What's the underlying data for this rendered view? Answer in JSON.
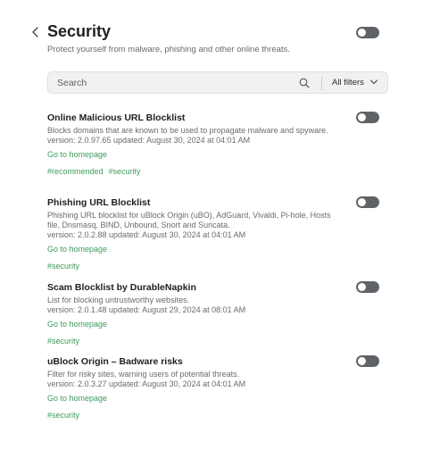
{
  "header": {
    "title": "Security",
    "subtitle": "Protect yourself from malware, phishing and other online threats."
  },
  "search": {
    "placeholder": "Search",
    "filters_label": "All filters"
  },
  "filters": [
    {
      "title": "Online Malicious URL Blocklist",
      "description": "Blocks domains that are known to be used to propagate malware and spyware.",
      "version": "version: 2.0.97.65 updated: August 30, 2024 at 04:01 AM",
      "homepage": "Go to homepage",
      "tags": [
        "#recommended",
        "#security"
      ]
    },
    {
      "title": "Phishing URL Blocklist",
      "description": "Phishing URL blocklist for uBlock Origin (uBO), AdGuard, Vivaldi, Pi-hole, Hosts file, Dnsmasq, BIND, Unbound, Snort and Suricata.",
      "version": "version: 2.0.2.88 updated: August 30, 2024 at 04:01 AM",
      "homepage": "Go to homepage",
      "tags": [
        "#security"
      ]
    },
    {
      "title": "Scam Blocklist by DurableNapkin",
      "description": "List for blocking untrustworthy websites.",
      "version": "version: 2.0.1.48 updated: August 29, 2024 at 08:01 AM",
      "homepage": "Go to homepage",
      "tags": [
        "#security"
      ]
    },
    {
      "title": "uBlock Origin – Badware risks",
      "description": "Filter for risky sites, warning users of potential threats.",
      "version": "version: 2.0.3.27 updated: August 30, 2024 at 04:01 AM",
      "homepage": "Go to homepage",
      "tags": [
        "#security"
      ]
    }
  ],
  "colors": {
    "link": "#3e9b5c",
    "toggle_off": "#5f6368"
  }
}
